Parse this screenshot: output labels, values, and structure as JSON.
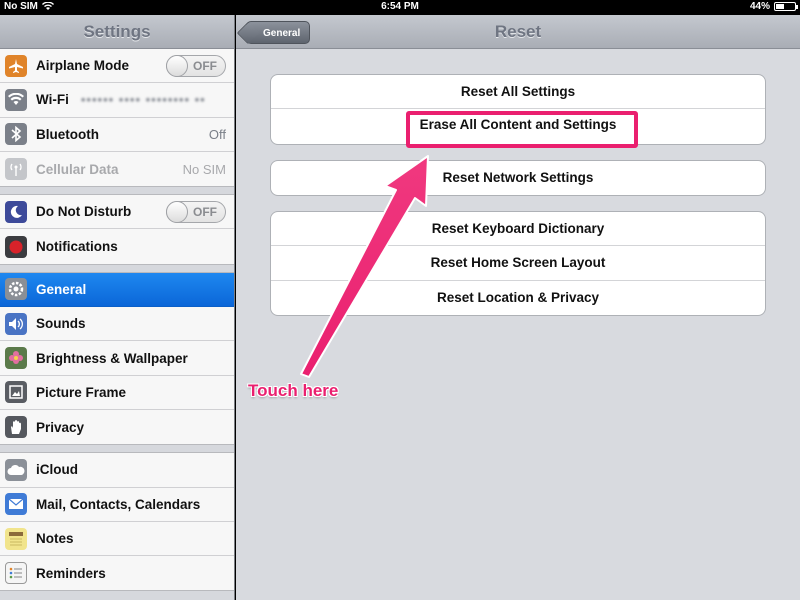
{
  "statusbar": {
    "carrier": "No SIM",
    "time": "6:54 PM",
    "battery": "44%",
    "battery_level": 0.44
  },
  "sidebar": {
    "title": "Settings",
    "groups": [
      [
        {
          "label": "Airplane Mode",
          "icon": "airplane-icon",
          "toggle": "OFF"
        },
        {
          "label": "Wi-Fi",
          "icon": "wifi-icon",
          "value": "•••••• •••• •••••••• ••"
        },
        {
          "label": "Bluetooth",
          "icon": "bluetooth-icon",
          "value": "Off"
        },
        {
          "label": "Cellular Data",
          "icon": "antenna-icon",
          "value": "No SIM"
        }
      ],
      [
        {
          "label": "Do Not Disturb",
          "icon": "moon-icon",
          "toggle": "OFF"
        },
        {
          "label": "Notifications",
          "icon": "notifications-icon"
        }
      ],
      [
        {
          "label": "General",
          "icon": "gear-icon"
        },
        {
          "label": "Sounds",
          "icon": "speaker-icon"
        },
        {
          "label": "Brightness & Wallpaper",
          "icon": "flower-icon"
        },
        {
          "label": "Picture Frame",
          "icon": "picture-frame-icon"
        },
        {
          "label": "Privacy",
          "icon": "hand-icon"
        }
      ],
      [
        {
          "label": "iCloud",
          "icon": "cloud-icon"
        },
        {
          "label": "Mail, Contacts, Calendars",
          "icon": "mail-icon"
        },
        {
          "label": "Notes",
          "icon": "notes-icon"
        },
        {
          "label": "Reminders",
          "icon": "reminders-icon"
        }
      ]
    ]
  },
  "main": {
    "back_label": "General",
    "title": "Reset",
    "groups": [
      [
        "Reset All Settings",
        "Erase All Content and Settings"
      ],
      [
        "Reset Network Settings"
      ],
      [
        "Reset Keyboard Dictionary",
        "Reset Home Screen Layout",
        "Reset Location & Privacy"
      ]
    ]
  },
  "annotation": {
    "text": "Touch here",
    "color": "#ea1f6f"
  },
  "colors": {
    "selected": "#1e88f0",
    "accent": "#ea1f6f"
  }
}
